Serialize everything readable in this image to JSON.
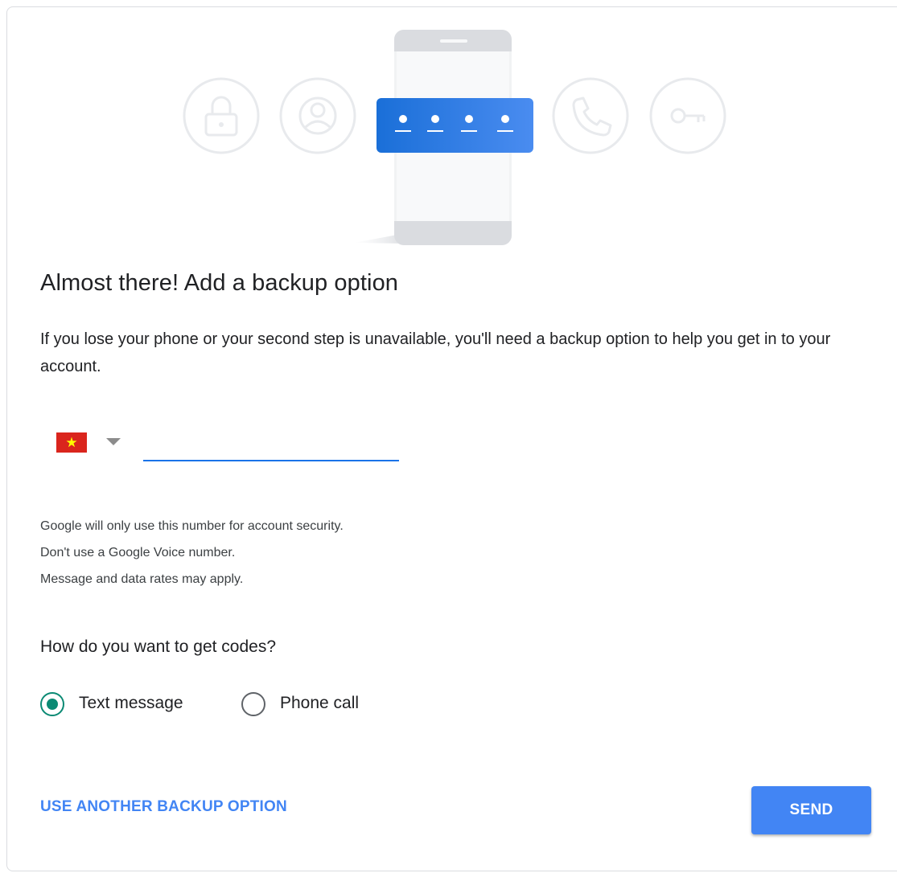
{
  "header": {
    "illustration_icons": [
      "lock-icon",
      "account-icon",
      "phone-with-code-icon",
      "phone-call-icon",
      "key-icon"
    ]
  },
  "title": "Almost there! Add a backup option",
  "description": "If you lose your phone or your second step is unavailable, you'll need a backup option to help you get in to your account.",
  "phone": {
    "country_flag": "vietnam-flag",
    "value": "",
    "placeholder": ""
  },
  "notes": [
    "Google will only use this number for account security.",
    "Don't use a Google Voice number.",
    "Message and data rates may apply."
  ],
  "codes": {
    "question": "How do you want to get codes?",
    "options": [
      {
        "label": "Text message",
        "selected": true
      },
      {
        "label": "Phone call",
        "selected": false
      }
    ]
  },
  "actions": {
    "secondary_label": "USE ANOTHER BACKUP OPTION",
    "primary_label": "SEND"
  },
  "colors": {
    "accent": "#4285f4",
    "input_underline": "#1a73e8",
    "radio_selected": "#0b8a74",
    "hero_code_box": "#3b7ae6"
  }
}
